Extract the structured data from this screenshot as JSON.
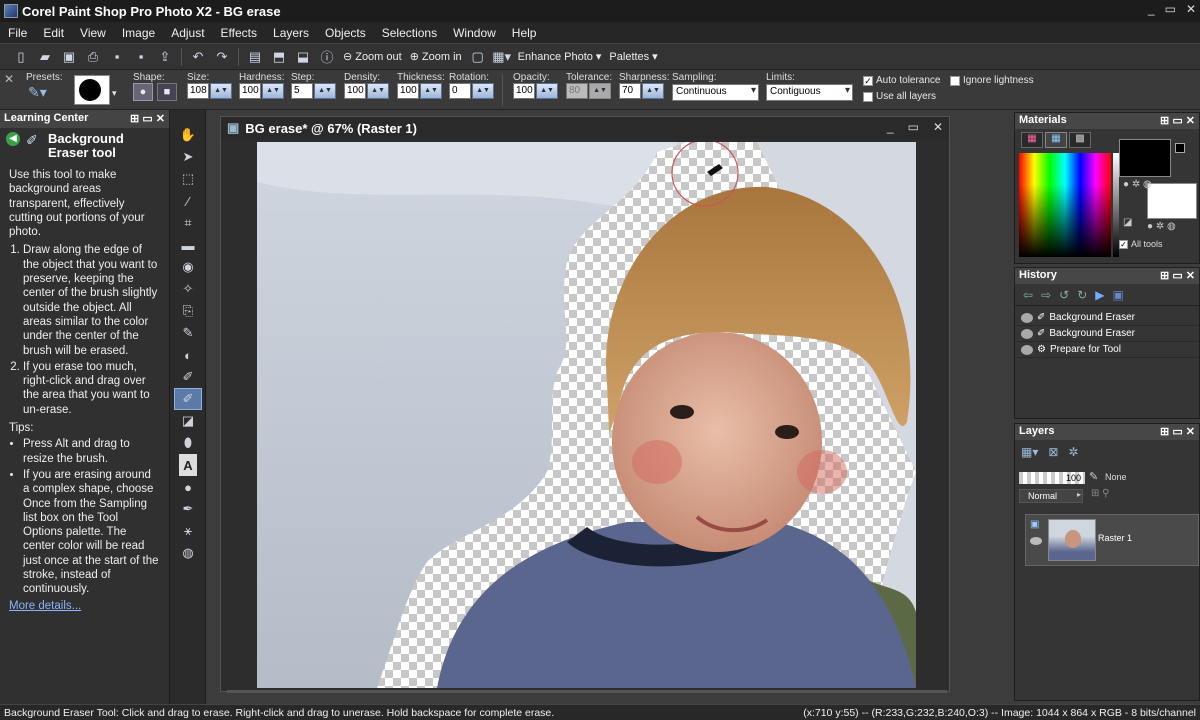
{
  "window": {
    "title": "Corel Paint Shop Pro Photo X2 - BG erase",
    "controls": [
      "_",
      "▭",
      "✕"
    ]
  },
  "menu": [
    "File",
    "Edit",
    "View",
    "Image",
    "Adjust",
    "Effects",
    "Layers",
    "Objects",
    "Selections",
    "Window",
    "Help"
  ],
  "toolbar": {
    "zoom_out": "Zoom out",
    "zoom_in": "Zoom in",
    "enhance": "Enhance Photo",
    "palettes": "Palettes"
  },
  "options": {
    "presets": "Presets:",
    "shape": "Shape:",
    "size_label": "Size:",
    "size": "108",
    "hardness_label": "Hardness:",
    "hardness": "100",
    "step_label": "Step:",
    "step": "5",
    "density_label": "Density:",
    "density": "100",
    "thickness_label": "Thickness:",
    "thickness": "100",
    "rotation_label": "Rotation:",
    "rotation": "0",
    "opacity_label": "Opacity:",
    "opacity": "100",
    "tolerance_label": "Tolerance:",
    "tolerance": "80",
    "sharpness_label": "Sharpness:",
    "sharpness": "70",
    "sampling_label": "Sampling:",
    "sampling": "Continuous",
    "limits_label": "Limits:",
    "limits": "Contiguous",
    "auto_tolerance": "Auto tolerance",
    "use_all_layers": "Use all layers",
    "ignore_lightness": "Ignore lightness",
    "auto_tolerance_checked": true,
    "use_all_layers_checked": false,
    "ignore_lightness_checked": false
  },
  "learning": {
    "header": "Learning Center",
    "title": "Background Eraser tool",
    "intro": "Use this tool to make background areas transparent, effectively cutting out portions of your photo.",
    "steps": [
      "Draw along the edge of the object that you want to preserve, keeping the center of the brush slightly outside the object. All areas similar to the color under the center of the brush will be erased.",
      "If you erase too much, right-click and drag over the area that you want to un-erase."
    ],
    "tips_label": "Tips:",
    "tips": [
      "Press Alt and drag to resize the brush.",
      "If you are erasing around a complex shape, choose Once from the Sampling list box on the Tool Options palette. The center color will be read just once at the start of the stroke, instead of continuously."
    ],
    "more": "More details..."
  },
  "document": {
    "title": "BG erase* @  67% (Raster 1)"
  },
  "materials": {
    "header": "Materials",
    "all_tools": "All tools",
    "fg_color": "#000000",
    "bg_color": "#ffffff"
  },
  "history": {
    "header": "History",
    "items": [
      "Background Eraser",
      "Background Eraser",
      "Prepare for Tool"
    ]
  },
  "layers": {
    "header": "Layers",
    "opacity": "100",
    "none": "None",
    "blend": "Normal",
    "layer_name": "Raster 1"
  },
  "status": {
    "left": "Background Eraser Tool: Click and drag to erase. Right-click and drag to unerase. Hold backspace for complete erase.",
    "right": "(x:710 y:55) -- (R:233,G:232,B:240,O:3) -- Image:  1044 x 864 x RGB - 8 bits/channel"
  }
}
